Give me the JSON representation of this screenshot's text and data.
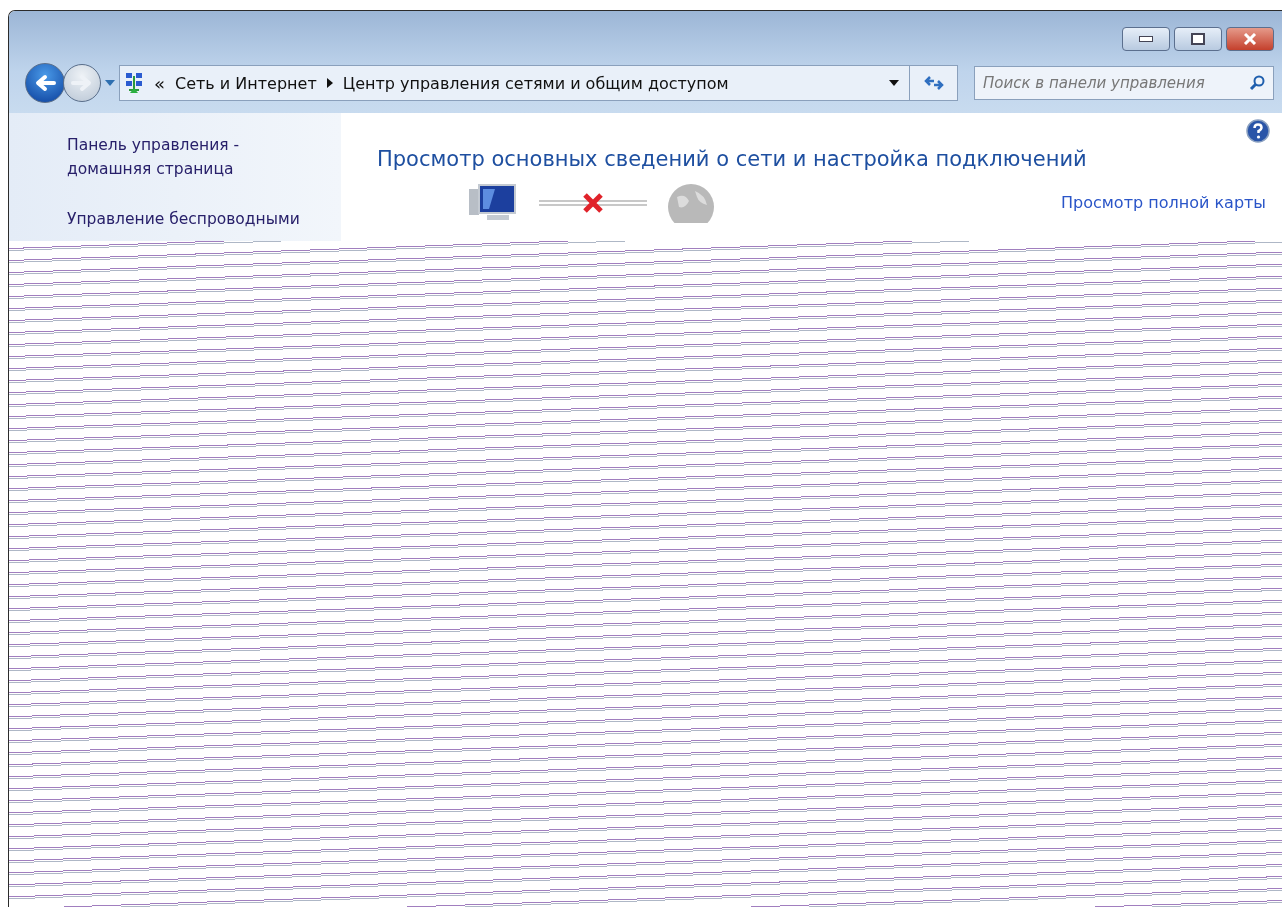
{
  "address_bar": {
    "overflow": "«",
    "breadcrumb": [
      {
        "label": "Сеть и Интернет"
      },
      {
        "label": "Центр управления сетями и общим доступом"
      }
    ]
  },
  "search": {
    "placeholder": "Поиск в панели управления"
  },
  "sidebar": {
    "items": [
      {
        "label": "Панель управления - домашняя страница"
      },
      {
        "label": "Управление беспроводными"
      }
    ]
  },
  "main": {
    "title": "Просмотр основных сведений о сети и настройка подключений",
    "map_link": "Просмотр полной карты",
    "internet_connected": false
  }
}
